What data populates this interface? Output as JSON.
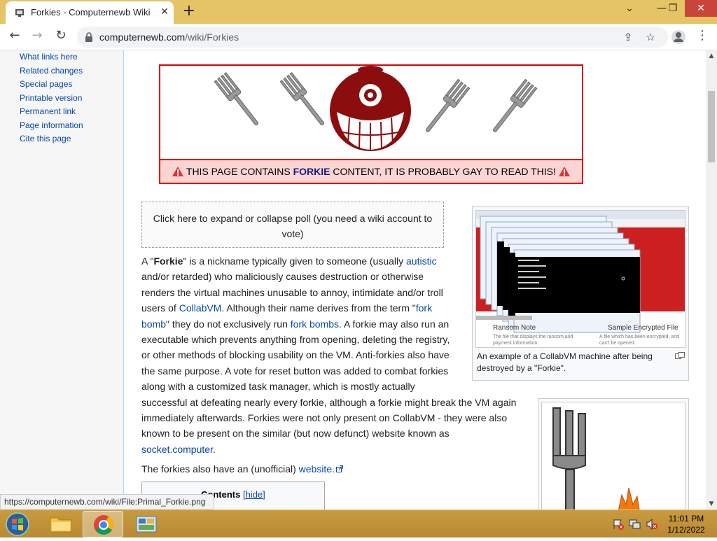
{
  "browser": {
    "tab_title": "Forkies - Computernewb Wiki",
    "tab_close": "✕",
    "new_tab": "+",
    "url_host": "computernewb.com",
    "url_path": "/wiki/Forkies",
    "window_min": "⌄",
    "window_minimize": "—",
    "window_restore": "❐",
    "window_close": "✕"
  },
  "sidebar": {
    "items": [
      {
        "label": "What links here"
      },
      {
        "label": "Related changes"
      },
      {
        "label": "Special pages"
      },
      {
        "label": "Printable version"
      },
      {
        "label": "Permanent link"
      },
      {
        "label": "Page information"
      },
      {
        "label": "Cite this page"
      }
    ]
  },
  "banner": {
    "text_before": " THIS PAGE CONTAINS ",
    "keyword": "FORKIE",
    "text_after": " CONTENT, IT IS PROBABLY GAY TO READ THIS! "
  },
  "poll": {
    "text": "Click here to expand or collapse poll (you need a wiki account to vote)"
  },
  "article": {
    "p1_lines": [
      [
        "A \"",
        {
          "b": "Forkie"
        },
        "\" is a nickname typically given to someone (usually ",
        {
          "a": "autistic"
        }
      ],
      [
        "and/or retarded) who maliciously causes destruction or otherwise"
      ],
      [
        "renders the virtual machines unusable to annoy, intimidate and/or troll"
      ],
      [
        "users of ",
        {
          "a": "CollabVM"
        },
        ". Although their name derives from the term \"",
        {
          "a": "fork"
        }
      ],
      [
        {
          "a": "bomb"
        },
        "\" they do not exclusively run ",
        {
          "a": "fork bombs"
        },
        ". A forkie may also run an"
      ],
      [
        "executable which prevents anything from opening, deleting the registry,"
      ],
      [
        "or other methods of blocking usability on the VM. Anti-forkies also have"
      ],
      [
        "the same purpose. A vote for reset button was added to combat forkies"
      ],
      [
        "along with a customized task manager, which is mostly actually"
      ],
      [
        "successful at defeating nearly every forkie, although a forkie might break the VM again"
      ],
      [
        "immediately afterwards. Forkies were not only present on CollabVM - they were also"
      ],
      [
        "known to be present on the similar (but now defunct) website known as"
      ],
      [
        {
          "a": "socket.computer"
        },
        "."
      ]
    ],
    "p2_text": "The forkies also have an (unofficial) ",
    "p2_link": "website."
  },
  "figure1": {
    "caption": "An example of a CollabVM machine after being destroyed by a \"Forkie\".",
    "inner_labels": [
      "Ransom Note",
      "Sample Encrypted File",
      "The file that displays the ransom and payment information.",
      "A file which has been encrypted, and can't be opened."
    ]
  },
  "toc": {
    "title": "Contents",
    "hide": "[hide]"
  },
  "status_url": "https://computernewb.com/wiki/File:Primal_Forkie.png",
  "clock": {
    "time": "11:01 PM",
    "date": "1/12/2022"
  },
  "colors": {
    "tabbar": "#e4c465",
    "taskbar": "#c99a3e",
    "banner_border": "#dd0000",
    "banner_bg": "#fbd4d4",
    "link": "#0645ad"
  }
}
